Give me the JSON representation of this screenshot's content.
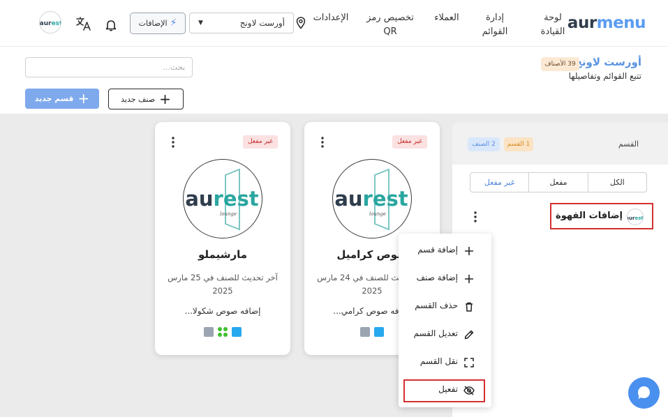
{
  "brand": {
    "logo_part1": "aur",
    "logo_part2": "menu"
  },
  "nav": {
    "dashboard": "لوحة القيادة",
    "menus": "إدارة القوائم",
    "customers": "العملاء",
    "qr": "تخصيص رمز QR",
    "settings": "الإعدادات"
  },
  "location_select": {
    "value": "أورست لاونج"
  },
  "addons_button": {
    "label": "الإضافات"
  },
  "header": {
    "venue": "أورست لاونج",
    "items_badge": "39 الأصناف",
    "subtitle": "تتبع القوائم وتفاصيلها"
  },
  "search": {
    "placeholder": "بحث..."
  },
  "buttons": {
    "new_section": "قسم جديد",
    "new_item": "صنف جديد"
  },
  "panel": {
    "title": "القسم",
    "section_badge": "1 القسم",
    "item_badge": "2 الصنف",
    "filters": [
      "الكل",
      "مفعل",
      "غير مفعل"
    ],
    "active_filter_index": 2,
    "section_name": "إضافات القهوة"
  },
  "menu": {
    "items": [
      "إضافة قسم",
      "إضافة صنف",
      "حذف القسم",
      "تعديل القسم",
      "نقل القسم",
      "تفعيل"
    ]
  },
  "cards": [
    {
      "status": "غير مفعل",
      "name": "صوص كراميل",
      "updated": "آخر تحديث للصنف في 24 مارس 2025",
      "desc": "إضافه صوص كرامي..."
    },
    {
      "status": "غير مفعل",
      "name": "مارشيملو",
      "updated": "آخر تحديث للصنف في 25 مارس 2025",
      "desc": "إضافه صوص شكولا..."
    }
  ],
  "colors": {
    "accent": "#5b9cf2",
    "primary_button": "#7ea9ec",
    "inactive_badge_bg": "#fbe1e1",
    "inactive_badge_text": "#c62828",
    "highlight_border": "#d32f2f",
    "workspace_bg": "#ebebeb"
  },
  "icons": {
    "addons": "bolt-icon",
    "location": "map-pin-icon",
    "language": "translate-icon",
    "notifications": "bell-icon",
    "menu_add_section": "plus-icon",
    "menu_add_item": "plus-icon",
    "menu_delete": "trash-icon",
    "menu_edit": "pencil-icon",
    "menu_move": "move-expand-icon",
    "menu_activate": "eye-off-icon",
    "chat": "chat-bubble-icon"
  }
}
